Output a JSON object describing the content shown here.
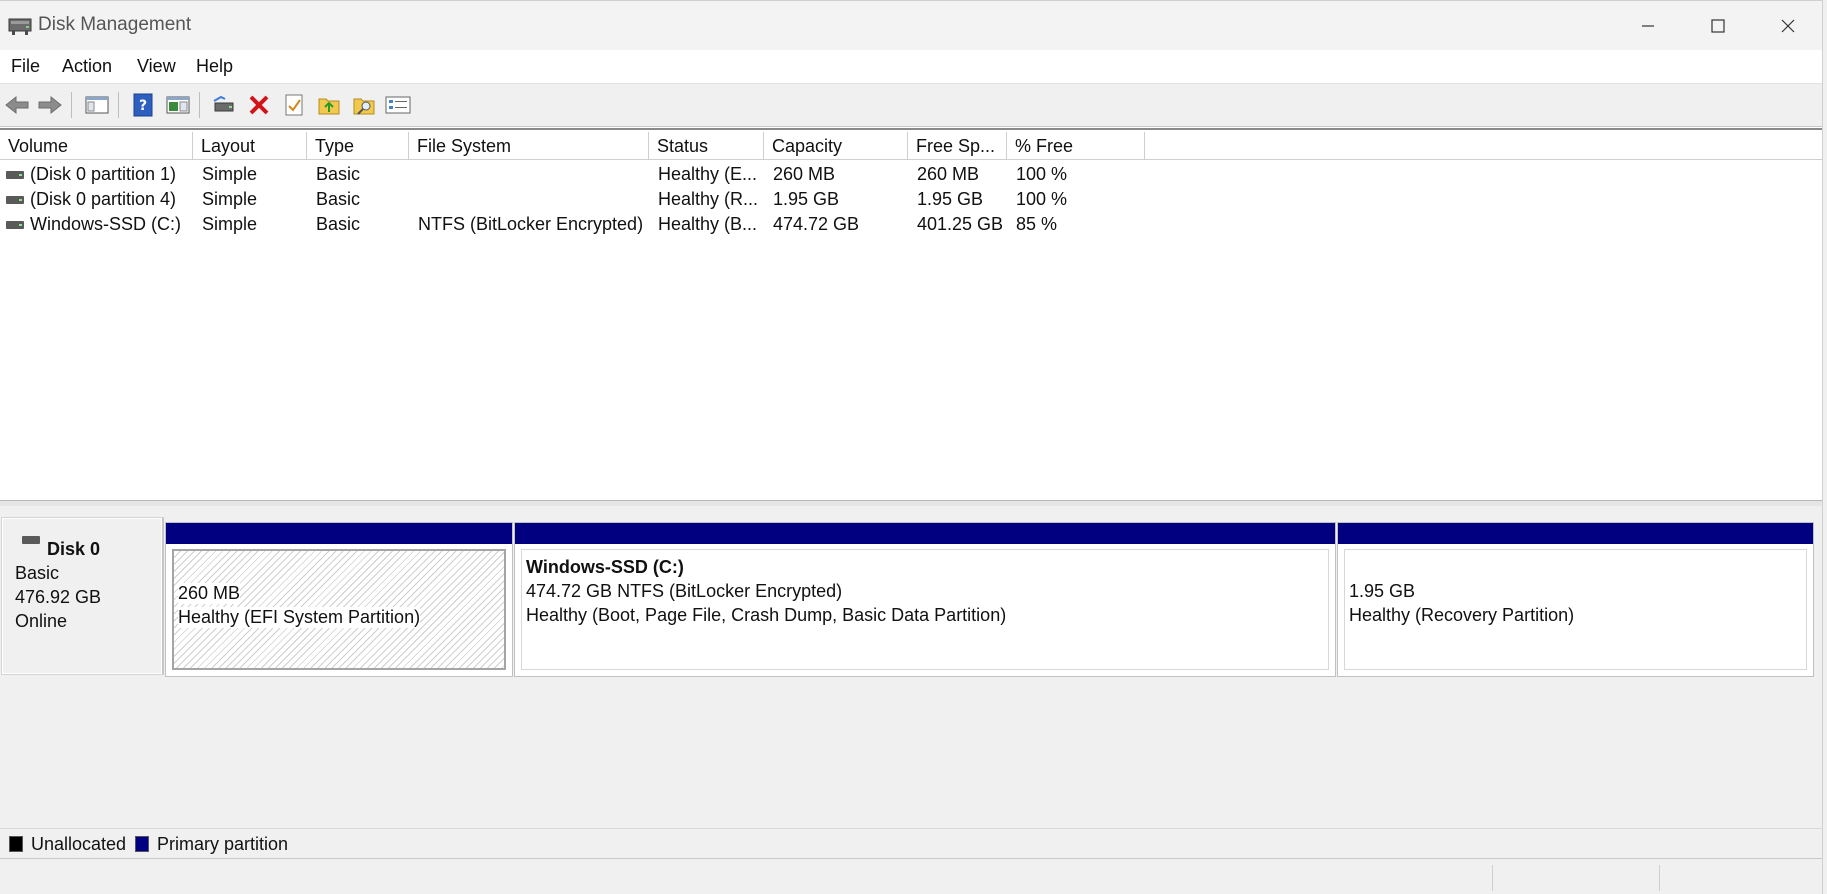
{
  "window": {
    "title": "Disk Management",
    "controls": {
      "minimize": "—",
      "maximize": "☐",
      "close": "✕"
    }
  },
  "menu": [
    "File",
    "Action",
    "View",
    "Help"
  ],
  "toolbar_icons": [
    "back-icon",
    "forward-icon",
    "show-hide-console-tree-icon",
    "help-icon",
    "show-hide-action-pane-icon",
    "connect-drive-icon",
    "delete-icon",
    "properties-icon",
    "folder-up-icon",
    "explore-icon",
    "list-view-icon"
  ],
  "volumes": {
    "columns": [
      "Volume",
      "Layout",
      "Type",
      "File System",
      "Status",
      "Capacity",
      "Free Sp...",
      "% Free"
    ],
    "rows": [
      {
        "volume": "(Disk 0 partition 1)",
        "layout": "Simple",
        "type": "Basic",
        "fs": "",
        "status": "Healthy (E...",
        "capacity": "260 MB",
        "free": "260 MB",
        "pct": "100 %"
      },
      {
        "volume": "(Disk 0 partition 4)",
        "layout": "Simple",
        "type": "Basic",
        "fs": "",
        "status": "Healthy (R...",
        "capacity": "1.95 GB",
        "free": "1.95 GB",
        "pct": "100 %"
      },
      {
        "volume": "Windows-SSD (C:)",
        "layout": "Simple",
        "type": "Basic",
        "fs": "NTFS (BitLocker Encrypted)",
        "status": "Healthy (B...",
        "capacity": "474.72 GB",
        "free": "401.25 GB",
        "pct": "85 %"
      }
    ]
  },
  "disk": {
    "name": "Disk 0",
    "type": "Basic",
    "size": "476.92 GB",
    "state": "Online",
    "partitions": [
      {
        "name": "",
        "line1": "260 MB",
        "line2": "Healthy (EFI System Partition)"
      },
      {
        "name": "Windows-SSD  (C:)",
        "line1": "474.72 GB NTFS (BitLocker Encrypted)",
        "line2": "Healthy (Boot, Page File, Crash Dump, Basic Data Partition)"
      },
      {
        "name": "",
        "line1": "1.95 GB",
        "line2": "Healthy (Recovery Partition)"
      }
    ]
  },
  "legend": {
    "items": [
      {
        "label": "Unallocated",
        "color": "#000000"
      },
      {
        "label": "Primary partition",
        "color": "#000080"
      }
    ]
  }
}
